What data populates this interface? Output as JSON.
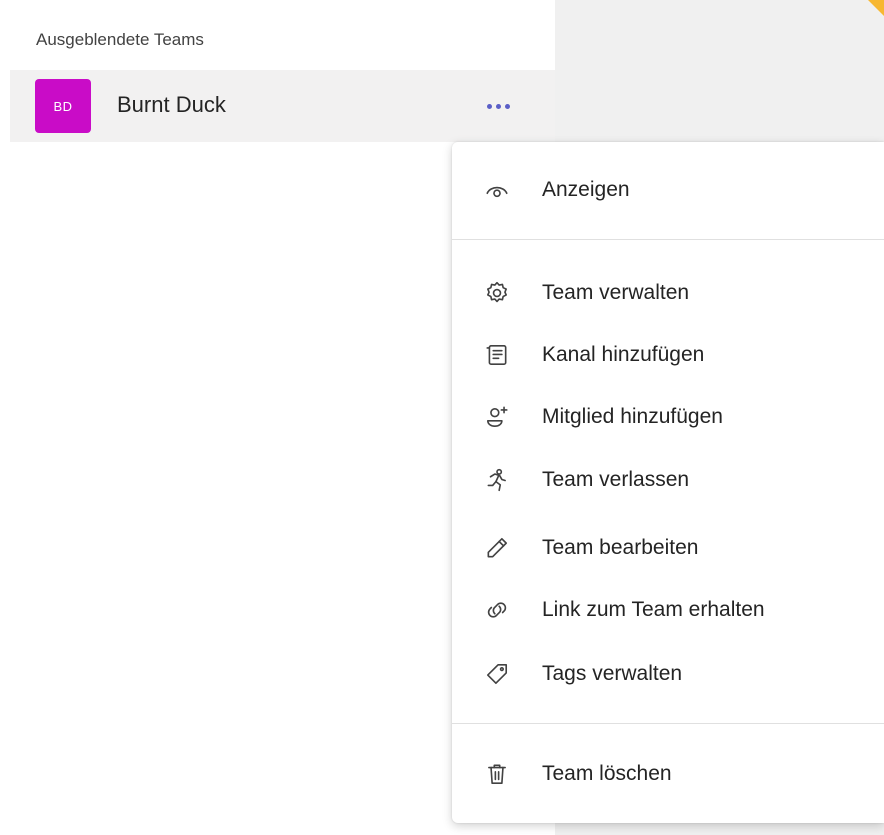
{
  "section": {
    "title": "Ausgeblendete Teams"
  },
  "team": {
    "initials": "BD",
    "name": "Burnt Duck",
    "avatar_color": "#c90cc7"
  },
  "menu": {
    "show": {
      "label": "Anzeigen",
      "icon": "eye-icon"
    },
    "items": [
      {
        "label": "Team verwalten",
        "icon": "gear-icon"
      },
      {
        "label": "Kanal hinzufügen",
        "icon": "channel-list-icon"
      },
      {
        "label": "Mitglied hinzufügen",
        "icon": "add-person-icon"
      },
      {
        "label": "Team verlassen",
        "icon": "running-person-icon"
      },
      {
        "label": "Team bearbeiten",
        "icon": "pencil-icon"
      },
      {
        "label": "Link zum Team erhalten",
        "icon": "link-icon"
      },
      {
        "label": "Tags verwalten",
        "icon": "tag-icon"
      }
    ],
    "delete": {
      "label": "Team löschen",
      "icon": "trash-icon"
    }
  },
  "colors": {
    "accent": "#5b5fc7",
    "corner": "#f7b731"
  }
}
